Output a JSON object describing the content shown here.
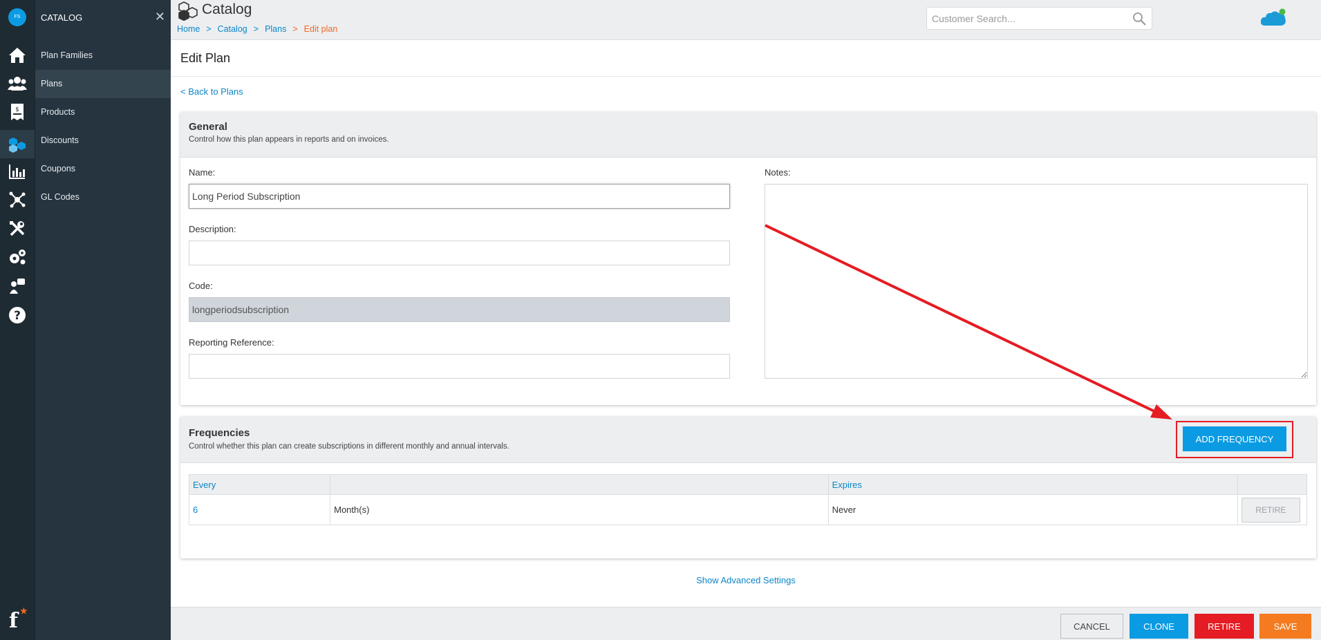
{
  "rail": {
    "logo_text": "FS",
    "icons": [
      "home-icon",
      "people-icon",
      "invoice-icon",
      "catalog-icon",
      "chart-icon",
      "network-icon",
      "tools-icon",
      "gears-icon",
      "support-icon",
      "help-icon"
    ],
    "brand_letter": "f",
    "brand_star": "★"
  },
  "panel": {
    "title": "CATALOG",
    "close": "✕",
    "items": [
      {
        "label": "Plan Families",
        "active": false
      },
      {
        "label": "Plans",
        "active": true
      },
      {
        "label": "Products",
        "active": false
      },
      {
        "label": "Discounts",
        "active": false
      },
      {
        "label": "Coupons",
        "active": false
      },
      {
        "label": "GL Codes",
        "active": false
      }
    ]
  },
  "header": {
    "title": "Catalog",
    "breadcrumbs": [
      "Home",
      "Catalog",
      "Plans"
    ],
    "breadcrumb_current": "Edit plan",
    "separator": ">",
    "search_placeholder": "Customer Search..."
  },
  "page": {
    "title": "Edit Plan",
    "back_link": "< Back to Plans"
  },
  "general": {
    "title": "General",
    "subtitle": "Control how this plan appears in reports and on invoices.",
    "name_label": "Name:",
    "name_value": "Long Period Subscription",
    "description_label": "Description:",
    "description_value": "",
    "code_label": "Code:",
    "code_value": "longperiodsubscription",
    "reporting_label": "Reporting Reference:",
    "reporting_value": "",
    "notes_label": "Notes:",
    "notes_value": ""
  },
  "frequencies": {
    "title": "Frequencies",
    "subtitle": "Control whether this plan can create subscriptions in different monthly and annual intervals.",
    "add_button": "ADD FREQUENCY",
    "columns": [
      "Every",
      "Expires"
    ],
    "rows": [
      {
        "every": "6",
        "unit": "Month(s)",
        "expires": "Never",
        "action": "RETIRE"
      }
    ]
  },
  "advanced_link": "Show Advanced Settings",
  "footer": {
    "cancel": "CANCEL",
    "clone": "CLONE",
    "retire": "RETIRE",
    "save": "SAVE"
  },
  "colors": {
    "accent": "#0b9be3",
    "link": "#0b86c9",
    "danger": "#e51c23",
    "save": "#f47b20",
    "sidebar": "#1f2b33"
  }
}
